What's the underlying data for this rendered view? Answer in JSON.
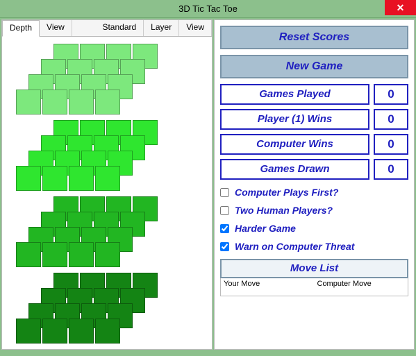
{
  "window": {
    "title": "3D Tic Tac Toe"
  },
  "tabs": {
    "left": {
      "depth": "Depth",
      "view": "View"
    },
    "right": {
      "standard": "Standard",
      "layer": "Layer",
      "view": "View"
    }
  },
  "buttons": {
    "reset_scores": "Reset Scores",
    "new_game": "New Game"
  },
  "scores": {
    "games_played": {
      "label": "Games Played",
      "value": "0"
    },
    "player1_wins": {
      "label": "Player (1) Wins",
      "value": "0"
    },
    "computer_wins": {
      "label": "Computer Wins",
      "value": "0"
    },
    "games_drawn": {
      "label": "Games Drawn",
      "value": "0"
    }
  },
  "options": {
    "computer_first": {
      "label": "Computer Plays First?",
      "checked": false
    },
    "two_humans": {
      "label": "Two Human Players?",
      "checked": false
    },
    "harder_game": {
      "label": "Harder Game",
      "checked": true
    },
    "warn_threat": {
      "label": "Warn on Computer Threat",
      "checked": true
    }
  },
  "movelist": {
    "header": "Move List",
    "col_your": "Your Move",
    "col_cpu": "Computer Move"
  }
}
